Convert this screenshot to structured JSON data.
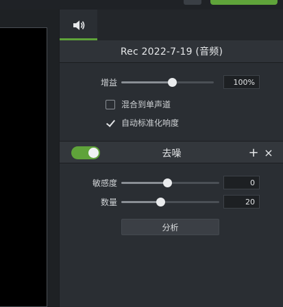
{
  "tabs": [
    {
      "icon": "speaker-icon",
      "active": true
    }
  ],
  "clip": {
    "title": "Rec 2022-7-19 (音频)"
  },
  "gain": {
    "label": "增益",
    "value_text": "100%",
    "slider_fraction": 0.55
  },
  "options": [
    {
      "label": "混合到单声道",
      "checked": false
    },
    {
      "label": "自动标准化响度",
      "checked": true
    }
  ],
  "denoise": {
    "title": "去噪",
    "enabled": true,
    "add_icon": "+",
    "close_icon": "×",
    "sensitivity": {
      "label": "敏感度",
      "value_text": "0",
      "slider_fraction": 0.47
    },
    "amount": {
      "label": "数量",
      "value_text": "20",
      "slider_fraction": 0.4
    },
    "analyze_label": "分析"
  },
  "colors": {
    "accent": "#5fa33a",
    "panel": "#2a2e33",
    "background": "#1e2124"
  }
}
